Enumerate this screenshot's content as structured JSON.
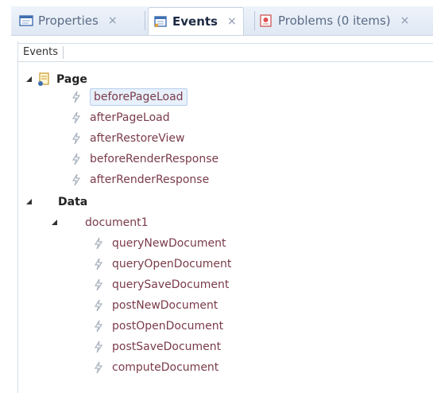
{
  "tabs": [
    {
      "label": "Properties",
      "close": "×"
    },
    {
      "label": "Events",
      "close": "×"
    },
    {
      "label": "Problems (0 items)",
      "close": "×"
    }
  ],
  "panel": {
    "header_label": "Events"
  },
  "tree": {
    "page": {
      "label": "Page",
      "events": [
        "beforePageLoad",
        "afterPageLoad",
        "afterRestoreView",
        "beforeRenderResponse",
        "afterRenderResponse"
      ]
    },
    "data": {
      "label": "Data",
      "source": "document1",
      "events": [
        "queryNewDocument",
        "queryOpenDocument",
        "querySaveDocument",
        "postNewDocument",
        "postOpenDocument",
        "postSaveDocument",
        "computeDocument"
      ]
    },
    "selected": "beforePageLoad"
  },
  "colors": {
    "tab_strip": "#dfe8f4",
    "event_text": "#7a3b4a",
    "selection_bg": "#e7f0fb",
    "selection_border": "#b7cfee"
  }
}
